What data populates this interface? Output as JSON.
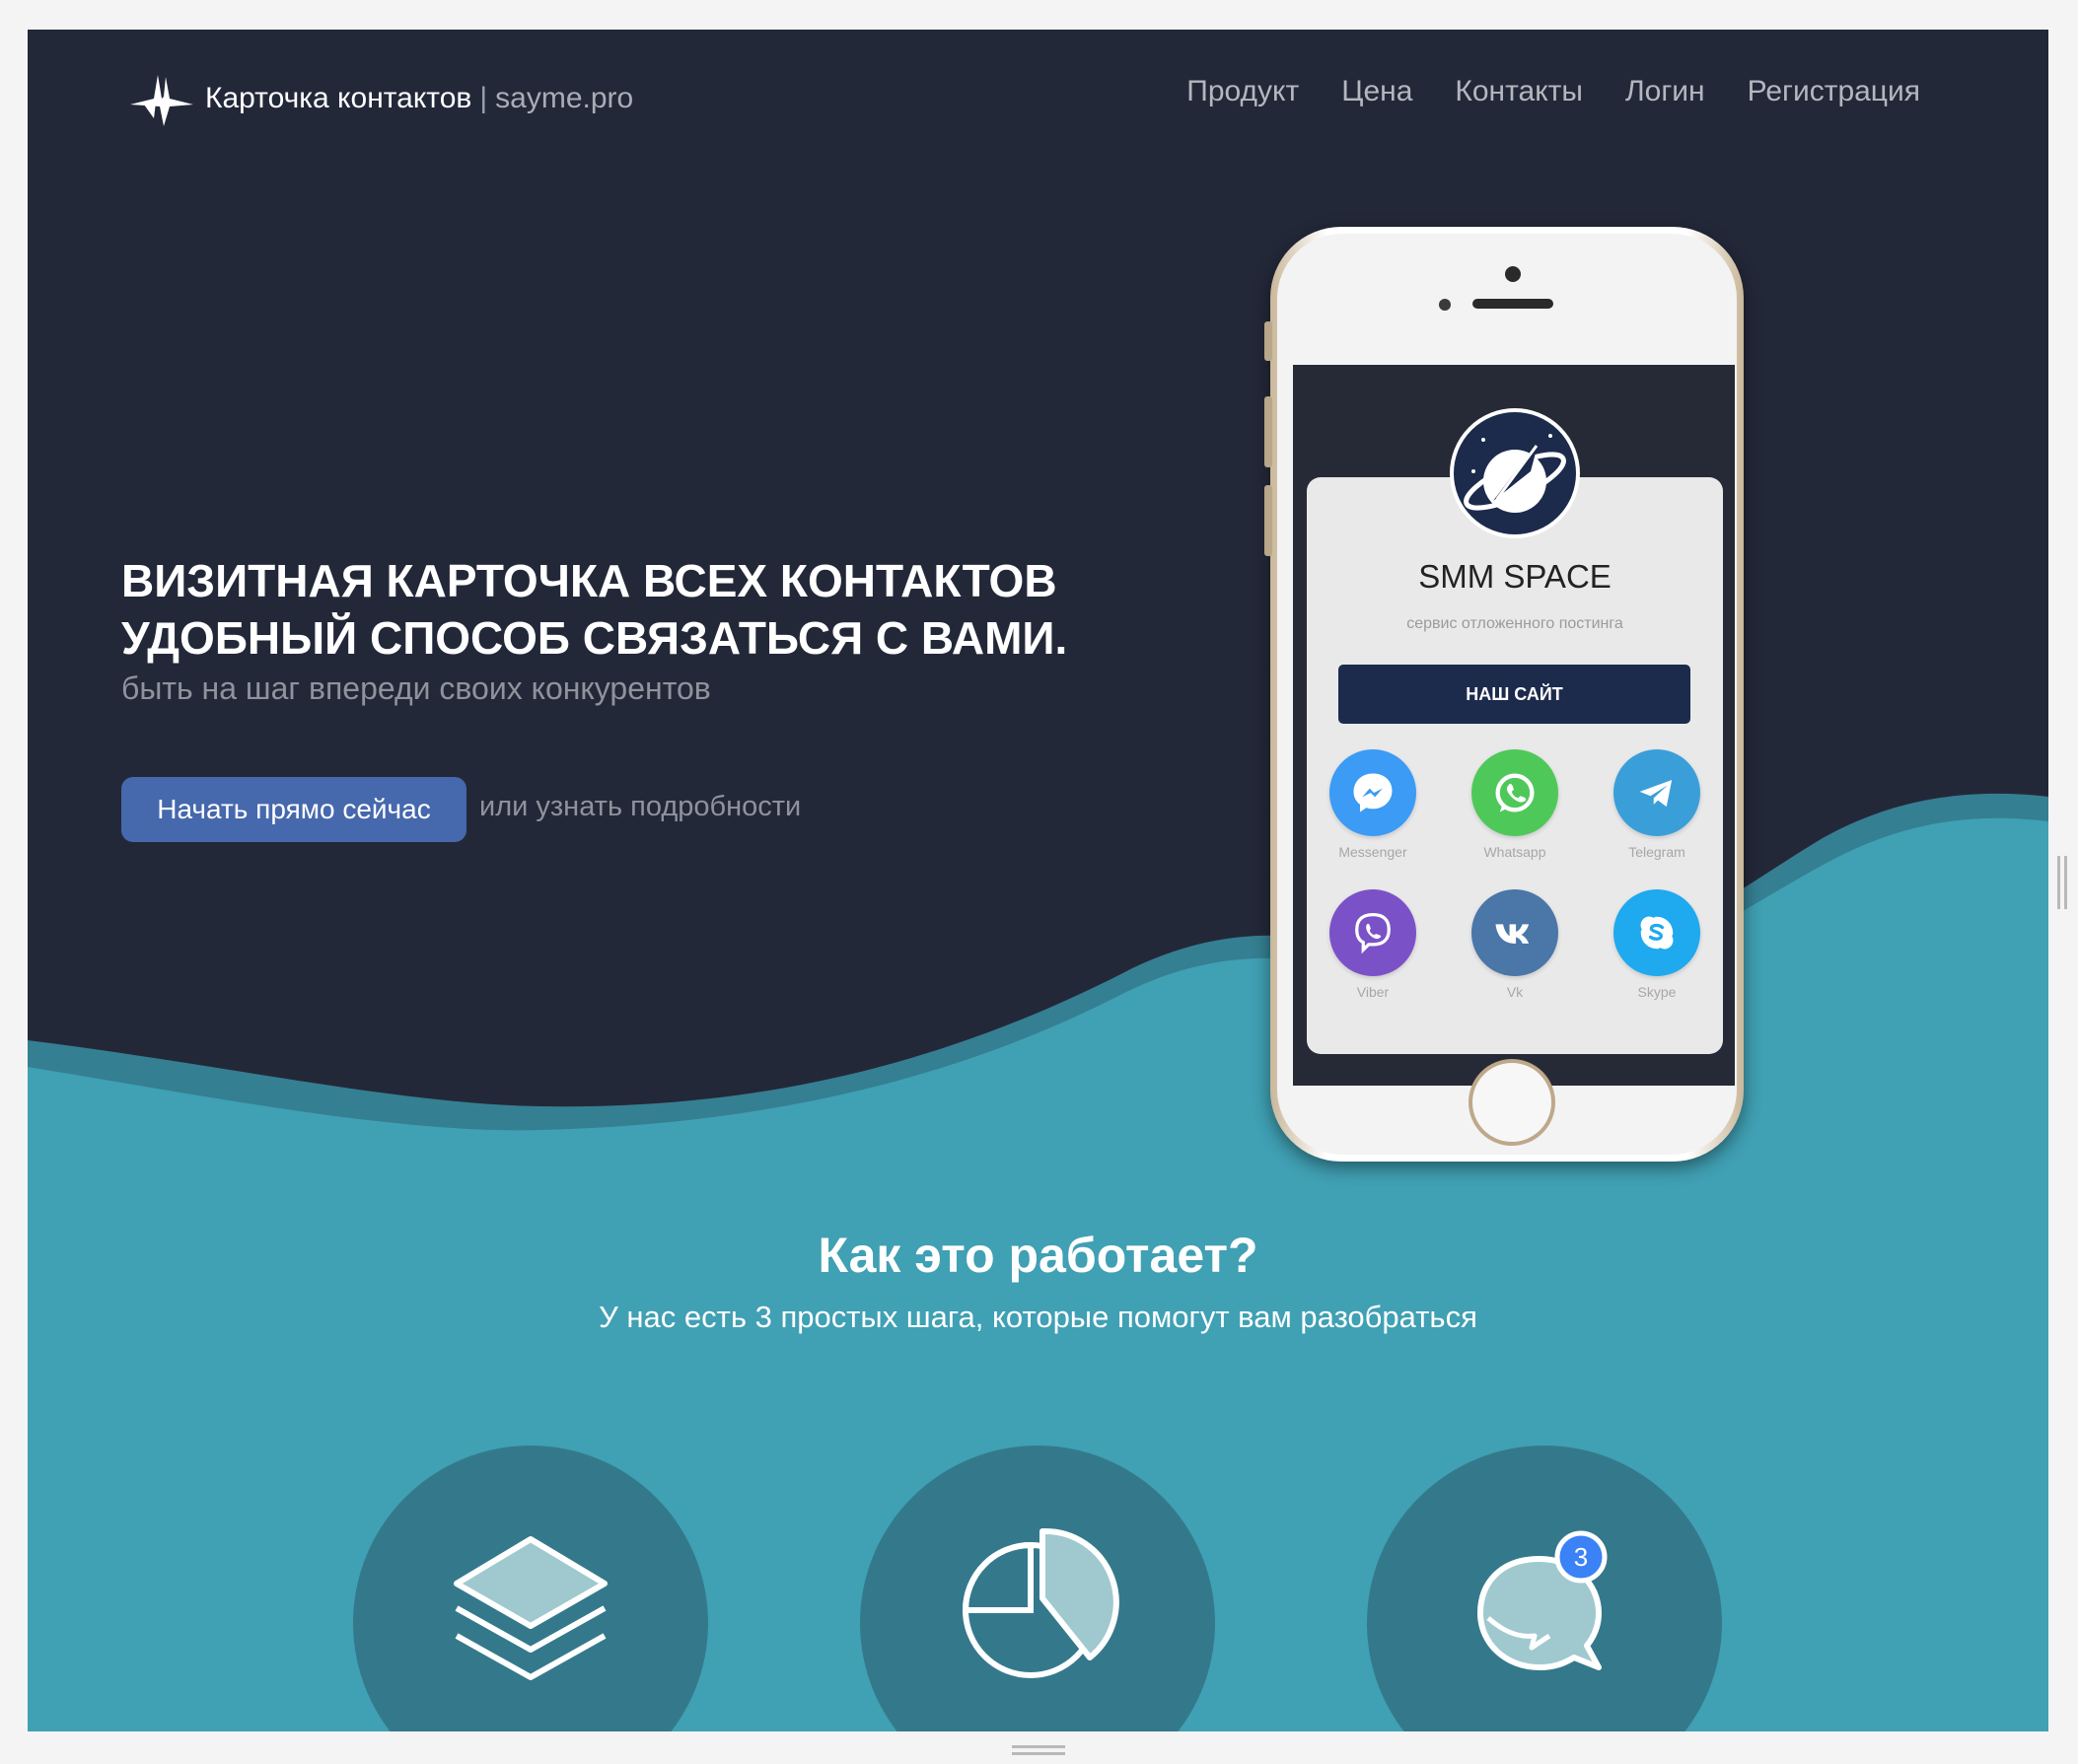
{
  "header": {
    "logo_text": "Карточка контактов",
    "logo_separator": "|",
    "logo_domain": "sayme.pro",
    "nav": [
      "Продукт",
      "Цена",
      "Контакты",
      "Логин",
      "Регистрация"
    ]
  },
  "hero": {
    "title_line1": "ВИЗИТНАЯ КАРТОЧКА ВСЕХ КОНТАКТОВ",
    "title_line2": "УДОБНЫЙ СПОСОБ СВЯЗАТЬСЯ С ВАМИ.",
    "subtitle": "быть на шаг впереди своих конкурентов",
    "cta_label": "Начать прямо сейчас",
    "cta_alt": "или узнать подробности"
  },
  "phone_card": {
    "brand_name": "SMM SPACE",
    "brand_desc": "сервис отложенного постинга",
    "site_button": "НАШ САЙТ",
    "messengers": [
      {
        "label": "Messenger",
        "icon": "messenger-icon",
        "color": "#3b9bf5"
      },
      {
        "label": "Whatsapp",
        "icon": "whatsapp-icon",
        "color": "#4fc85a"
      },
      {
        "label": "Telegram",
        "icon": "telegram-icon",
        "color": "#3a9fd8"
      },
      {
        "label": "Viber",
        "icon": "viber-icon",
        "color": "#7b51c7"
      },
      {
        "label": "Vk",
        "icon": "vk-icon",
        "color": "#4a76a8"
      },
      {
        "label": "Skype",
        "icon": "skype-icon",
        "color": "#1fa9ee"
      }
    ]
  },
  "how": {
    "title": "Как это работает?",
    "subtitle": "У нас есть 3 простых шага, которые помогут вам разобраться",
    "steps": [
      {
        "icon": "layers-icon"
      },
      {
        "icon": "pie-chart-icon"
      },
      {
        "icon": "chat-bubble-icon",
        "badge": "3"
      }
    ]
  },
  "colors": {
    "hero_bg": "#232839",
    "wave_teal": "#40a0b4",
    "wave_shadow": "#357f92",
    "cta": "#4668ad",
    "step_circle": "#34798b"
  }
}
